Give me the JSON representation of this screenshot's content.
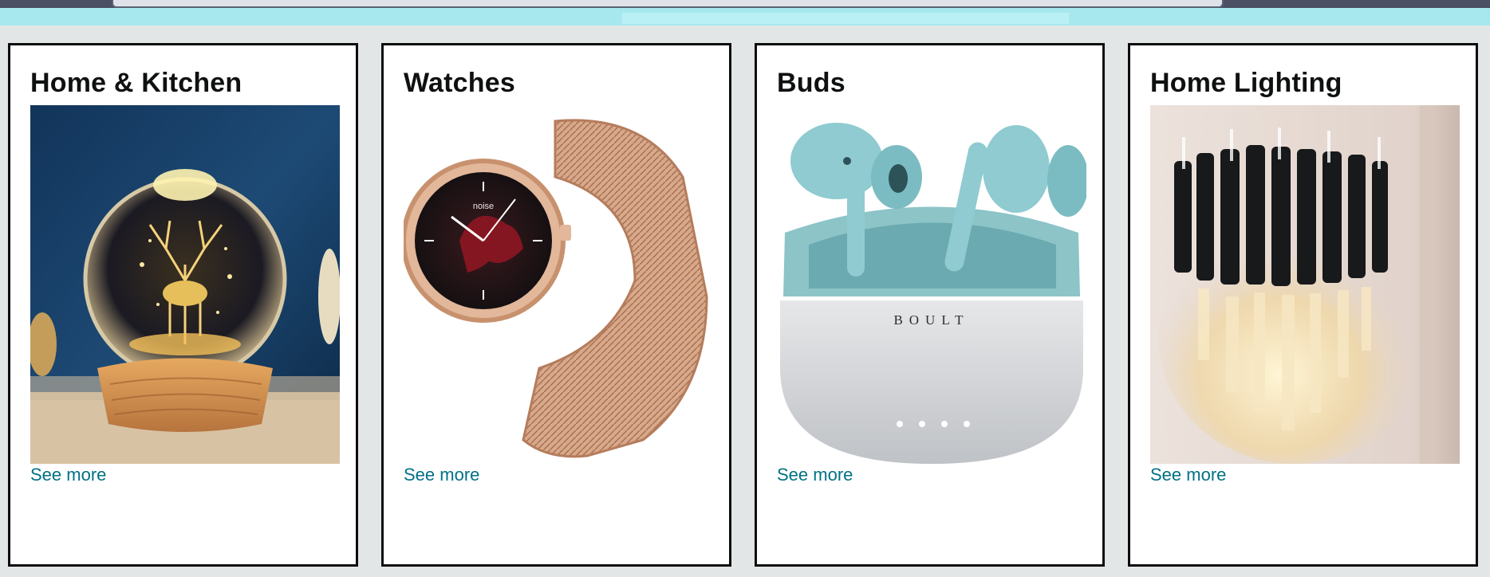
{
  "cards": [
    {
      "title": "Home & Kitchen",
      "link": "See more",
      "image": "crystal-ball-lamp"
    },
    {
      "title": "Watches",
      "link": "See more",
      "image": "rose-gold-smartwatch"
    },
    {
      "title": "Buds",
      "link": "See more",
      "image": "wireless-earbuds"
    },
    {
      "title": "Home Lighting",
      "link": "See more",
      "image": "crystal-wall-sconce"
    }
  ],
  "product_marks": {
    "watch_brand": "noise",
    "earbuds_brand": "BOULT"
  },
  "colors": {
    "link": "#007185",
    "page_bg": "#e3e6e6",
    "banner": "#a7e8ef"
  }
}
